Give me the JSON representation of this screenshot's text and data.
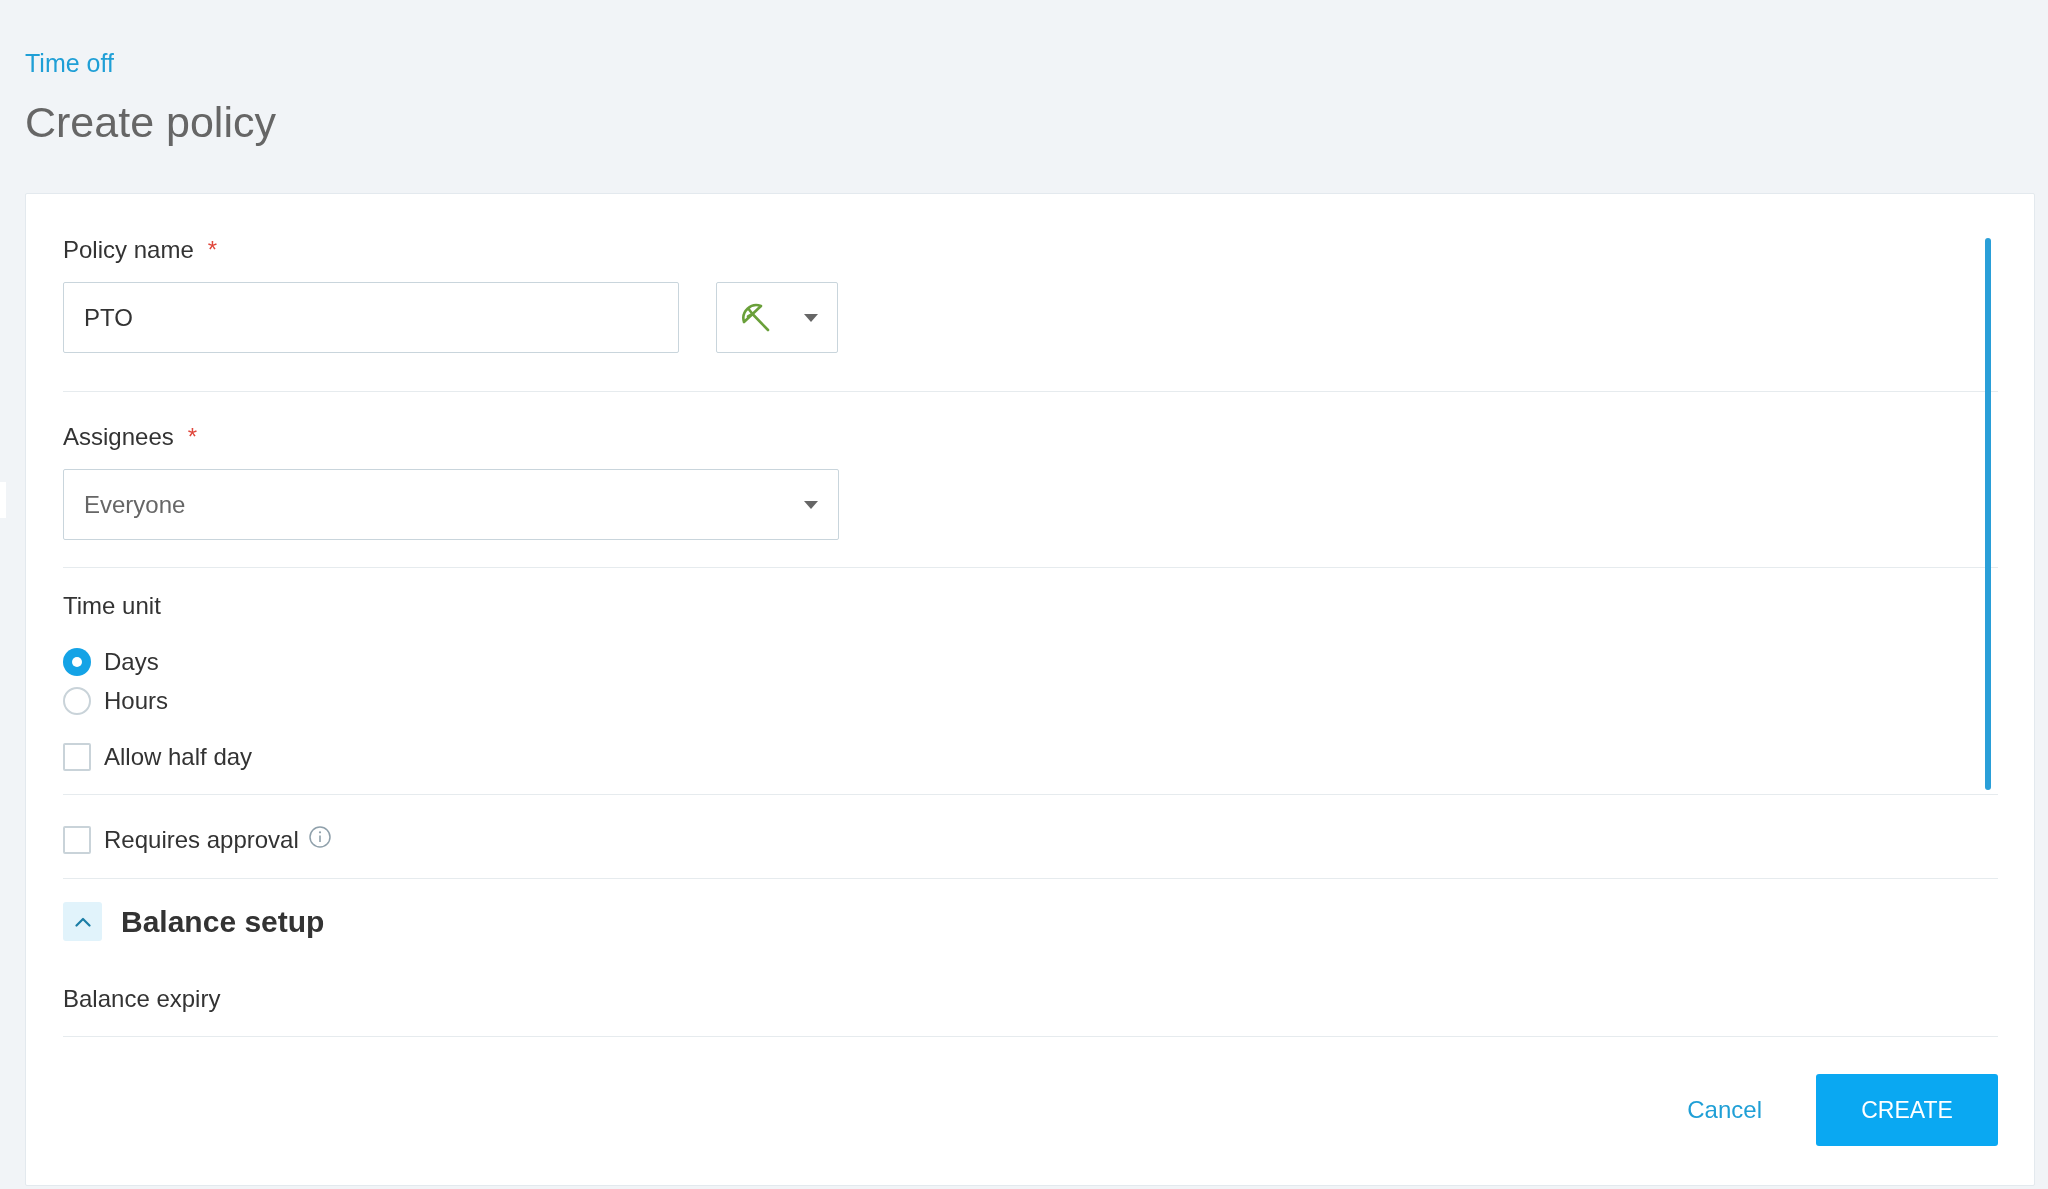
{
  "breadcrumb": "Time off",
  "title": "Create policy",
  "form": {
    "policy_name": {
      "label": "Policy name",
      "required_mark": "*",
      "value": "PTO"
    },
    "assignees": {
      "label": "Assignees",
      "required_mark": "*",
      "value": "Everyone"
    },
    "time_unit": {
      "label": "Time unit",
      "options": [
        {
          "label": "Days",
          "selected": true
        },
        {
          "label": "Hours",
          "selected": false
        }
      ]
    },
    "allow_half_day": {
      "label": "Allow half day",
      "checked": false
    },
    "requires_approval": {
      "label": "Requires approval",
      "checked": false
    },
    "balance_setup": {
      "title": "Balance setup",
      "expanded": true,
      "fields": [
        {
          "label": "Balance expiry"
        }
      ]
    }
  },
  "actions": {
    "cancel": "Cancel",
    "create": "CREATE"
  }
}
